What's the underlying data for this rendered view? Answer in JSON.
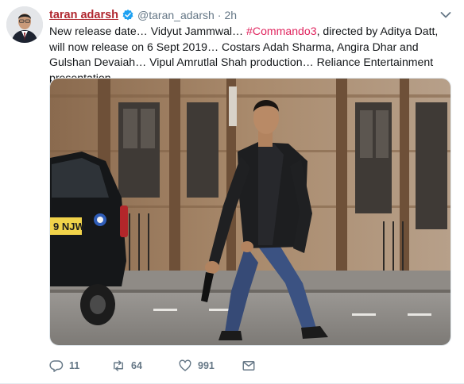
{
  "tweet": {
    "display_name": "taran adarsh",
    "handle": "@taran_adarsh",
    "separator": "·",
    "time": "2h",
    "text_part1": "New release date… Vidyut Jammwal… ",
    "hashtag": "#Commando3",
    "text_part2": ", directed by Aditya Datt, will now release on 6 Sept 2019… Costars Adah Sharma, Angira Dhar and Gulshan Devaiah… Vipul Amrutlal Shah production… Reliance Entertainment presentation.",
    "license_plate": "9 NJW"
  },
  "actions": {
    "reply_count": "11",
    "retweet_count": "64",
    "like_count": "991"
  },
  "icons": {
    "verified": "verified-badge-icon",
    "caret": "chevron-down-icon",
    "reply": "reply-icon",
    "retweet": "retweet-icon",
    "like": "heart-icon",
    "dm": "envelope-icon"
  },
  "colors": {
    "name": "#b0272f",
    "hashtag": "#e0245e",
    "verified": "#1da1f2",
    "muted": "#657786"
  }
}
